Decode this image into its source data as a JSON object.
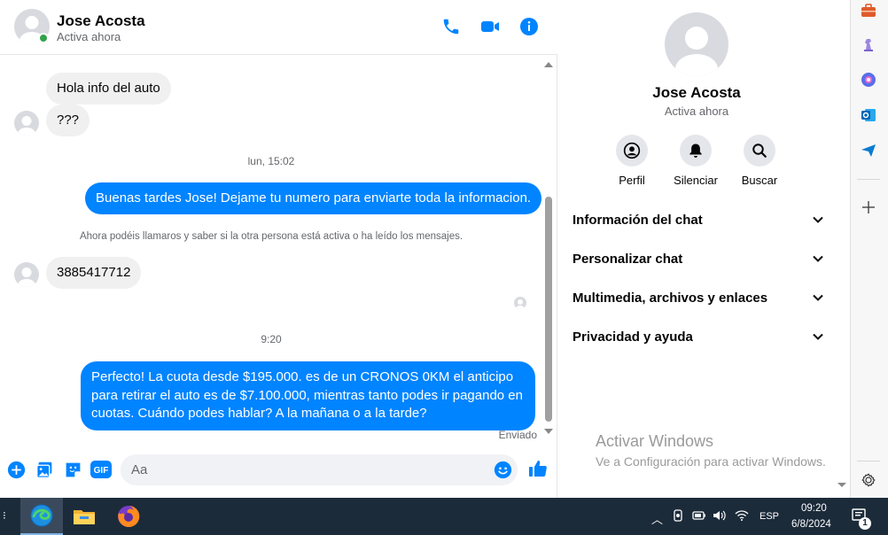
{
  "header": {
    "name": "Jose Acosta",
    "status": "Activa ahora",
    "icons": [
      "phone-icon",
      "video-icon",
      "info-icon"
    ]
  },
  "messages": [
    {
      "direction": "in",
      "text": "Hola info del auto"
    },
    {
      "direction": "in",
      "text": "???"
    },
    {
      "type": "timestamp",
      "text": "lun, 15:02"
    },
    {
      "direction": "out",
      "text": "Buenas tardes Jose! Dejame tu numero para enviarte toda la informacion."
    },
    {
      "type": "notice",
      "text": "Ahora podéis llamaros y saber si la otra persona está activa o ha leído los mensajes."
    },
    {
      "direction": "in",
      "text": "3885417712"
    },
    {
      "type": "timestamp",
      "text": "9:20"
    },
    {
      "direction": "out",
      "lines": [
        "Perfecto! La cuota desde $195.000. es de un CRONOS 0KM el anticipo",
        "para retirar el auto es de $7.100.000, mientras tanto podes ir pagando en",
        "cuotas. Cuándo podes hablar? A la mañana o a la tarde?"
      ]
    }
  ],
  "delivery_status": "Enviado",
  "composer": {
    "placeholder": "Aa",
    "left_icons": [
      "add-icon",
      "image-icon",
      "sticker-icon",
      "gif-icon"
    ],
    "gif_label": "GIF",
    "right_icons": [
      "emoji-icon",
      "like-icon"
    ]
  },
  "info_panel": {
    "name": "Jose Acosta",
    "status": "Activa ahora",
    "actions": [
      {
        "label": "Perfil",
        "icon": "profile-icon"
      },
      {
        "label": "Silenciar",
        "icon": "bell-icon"
      },
      {
        "label": "Buscar",
        "icon": "search-icon"
      }
    ],
    "sections": [
      "Información del chat",
      "Personalizar chat",
      "Multimedia, archivos y enlaces",
      "Privacidad y ayuda"
    ]
  },
  "watermark": {
    "title": "Activar Windows",
    "subtitle": "Ve a Configuración para activar Windows."
  },
  "taskbar": {
    "apps": [
      "edge-icon",
      "file-explorer-icon",
      "firefox-icon"
    ],
    "language": "ESP",
    "time": "09:20",
    "date": "6/8/2024",
    "notification_count": "1"
  },
  "colors": {
    "accent": "#0084ff",
    "incoming_bubble": "#f0f0f0",
    "online": "#31a24c",
    "taskbar": "#1c2b3a"
  }
}
